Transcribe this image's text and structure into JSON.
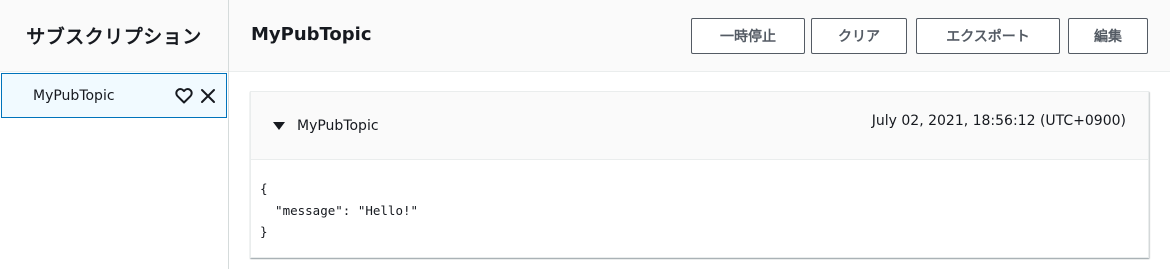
{
  "sidebar": {
    "title": "サブスクリプション",
    "subscriptions": [
      {
        "label": "MyPubTopic",
        "favorite_icon": "heart-outline-icon",
        "remove_icon": "close-icon"
      }
    ]
  },
  "header": {
    "topic_title": "MyPubTopic",
    "buttons": {
      "pause": "一時停止",
      "clear": "クリア",
      "export": "エクスポート",
      "edit": "編集"
    }
  },
  "messages": [
    {
      "topic": "MyPubTopic",
      "timestamp": "July 02, 2021, 18:56:12 (UTC+0900)",
      "expanded": true,
      "payload_lines": [
        "{",
        "  \"message\": \"Hello!\"",
        "}"
      ]
    }
  ],
  "colors": {
    "accent": "#0073bb",
    "selected_bg": "#f1faff",
    "header_bg": "#fafafa",
    "text": "#16191f",
    "button_border": "#545b64"
  }
}
